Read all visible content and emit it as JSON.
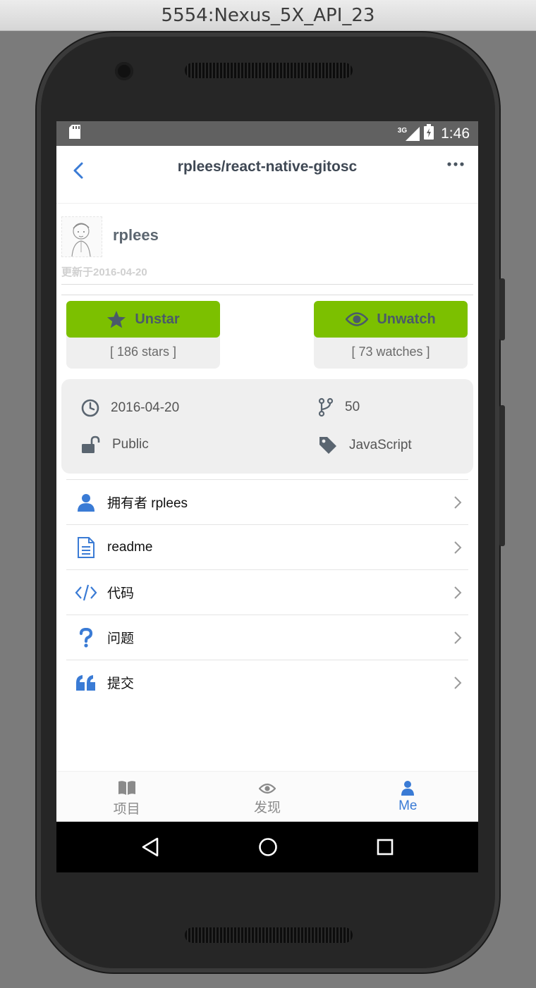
{
  "window": {
    "title": "5554:Nexus_5X_API_23"
  },
  "status_bar": {
    "network": "3G",
    "time": "1:46"
  },
  "nav": {
    "title": "rplees/react-native-gitosc"
  },
  "owner": {
    "name": "rplees",
    "updated": "更新于2016-04-20"
  },
  "actions": {
    "star": {
      "label": "Unstar",
      "count": "[ 186 stars ]"
    },
    "watch": {
      "label": "Unwatch",
      "count": "[ 73 watches ]"
    }
  },
  "info": {
    "date": "2016-04-20",
    "forks": "50",
    "visibility": "Public",
    "language": "JavaScript"
  },
  "menu": [
    {
      "label": "拥有者 rplees",
      "icon": "user-icon"
    },
    {
      "label": "readme",
      "icon": "document-icon"
    },
    {
      "label": "代码",
      "icon": "code-icon"
    },
    {
      "label": "问题",
      "icon": "question-icon"
    },
    {
      "label": "提交",
      "icon": "quote-icon"
    }
  ],
  "tabs": [
    {
      "label": "项目",
      "icon": "book-icon",
      "active": false
    },
    {
      "label": "发现",
      "icon": "eye-icon",
      "active": false
    },
    {
      "label": "Me",
      "icon": "person-icon",
      "active": true
    }
  ],
  "colors": {
    "accent": "#3a7bd5",
    "action_green": "#7cc000",
    "status_bar": "#616161"
  }
}
